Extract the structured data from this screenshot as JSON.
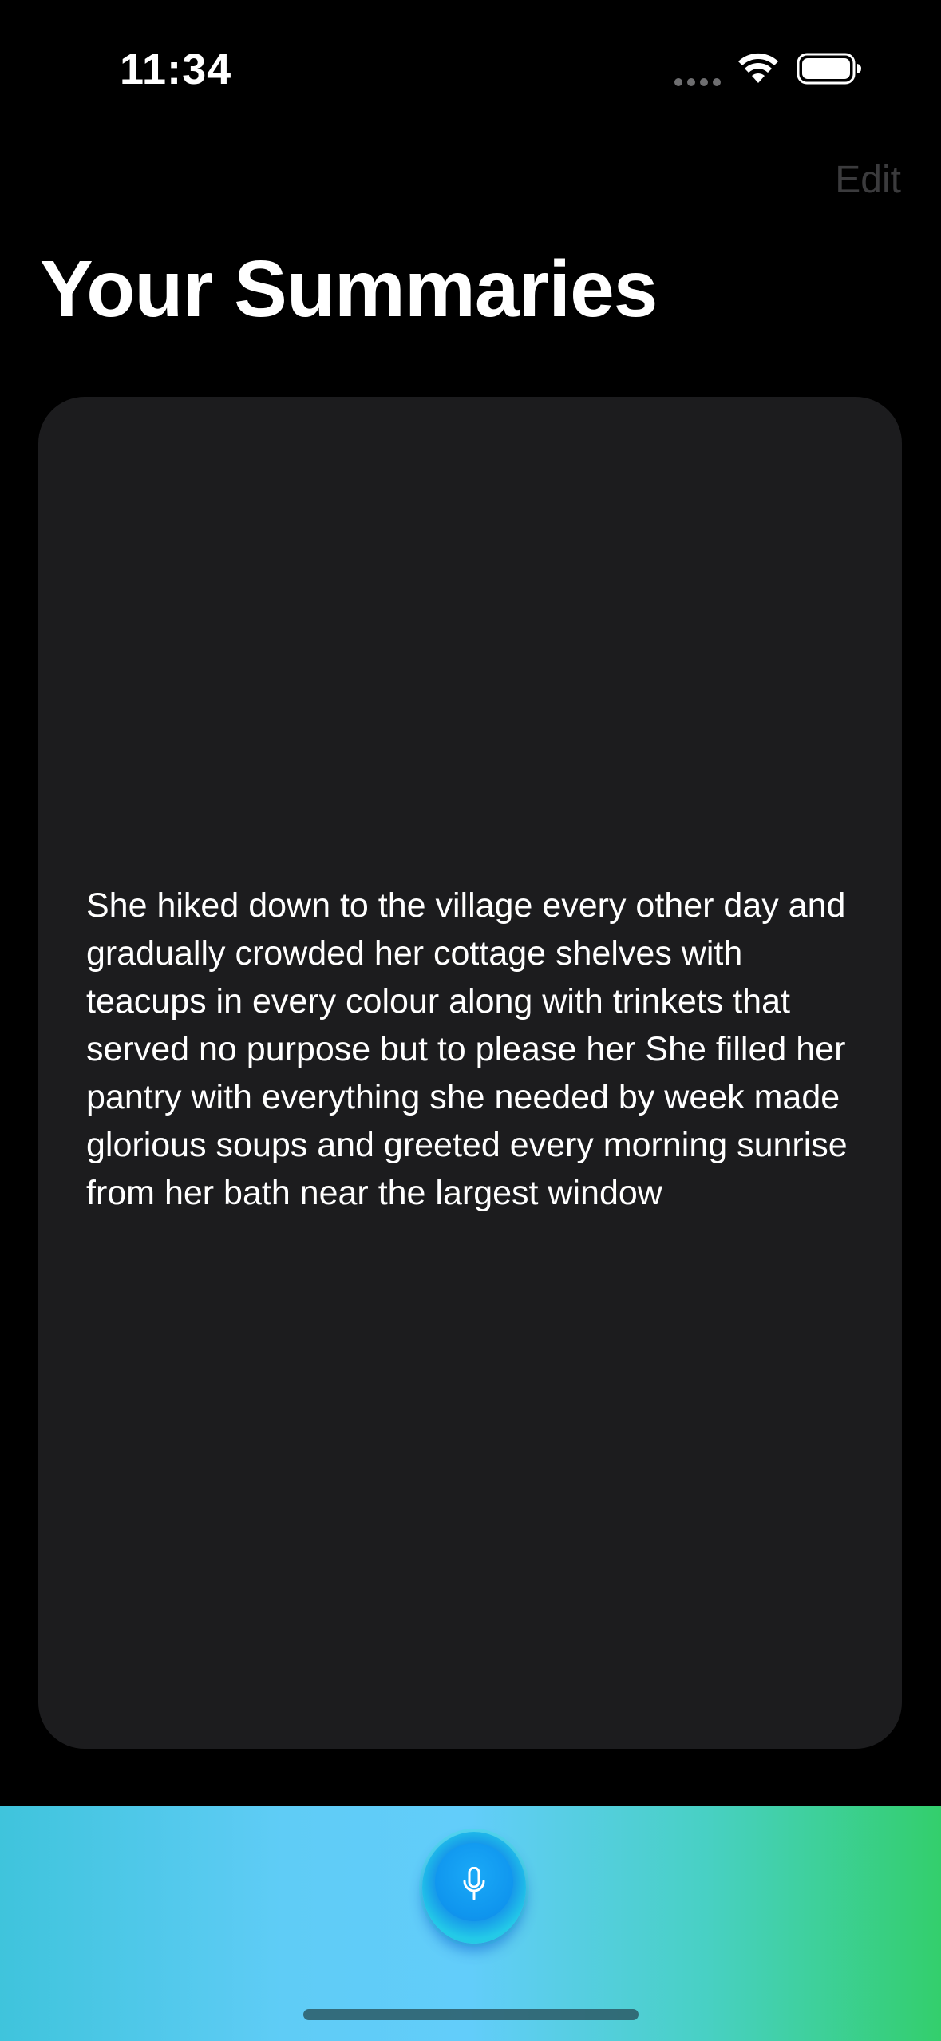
{
  "status_bar": {
    "time": "11:34",
    "icons": [
      "signal-icon",
      "wifi-icon",
      "battery-icon"
    ]
  },
  "nav": {
    "edit_label": "Edit"
  },
  "page": {
    "title": "Your Summaries"
  },
  "summaries": [
    {
      "text": "She hiked down to the village every other day and gradually crowded her cottage shelves with teacups in every colour along with trinkets that served no purpose but to please her She filled her pantry with everything she needed by week made glorious soups and greeted every morning sunrise from her bath near the largest window"
    }
  ],
  "bottom_bar": {
    "record_icon": "microphone-icon"
  },
  "colors": {
    "background": "#000000",
    "card": "#1c1c1e",
    "edit_text": "#3b3b3d",
    "gradient_start": "#3fc4dc",
    "gradient_mid": "#62cdfa",
    "gradient_end": "#33cf6c",
    "mic_button": "#1592ea"
  }
}
